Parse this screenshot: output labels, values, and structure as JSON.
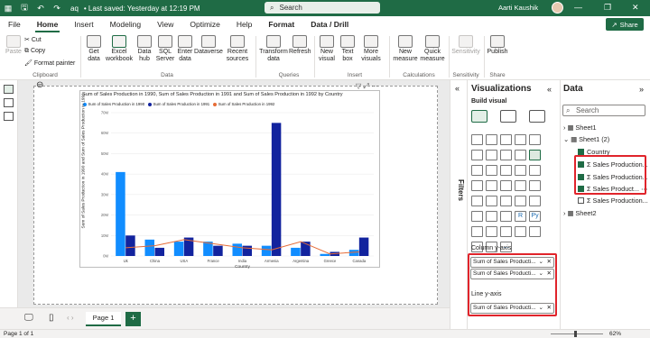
{
  "titlebar": {
    "filename": "aq",
    "saved": "• Last saved: Yesterday at 12:19 PM",
    "search_placeholder": "Search",
    "user": "Aarti Kaushik"
  },
  "menu": [
    "File",
    "Home",
    "Insert",
    "Modeling",
    "View",
    "Optimize",
    "Help",
    "Format",
    "Data / Drill"
  ],
  "share_label": "Share",
  "ribbon": {
    "paste": "Paste",
    "cut": "Cut",
    "copy": "Copy",
    "format_painter": "Format painter",
    "get_data": "Get data",
    "excel_workbook": "Excel workbook",
    "data_hub": "Data hub",
    "sql_server": "SQL Server",
    "enter_data": "Enter data",
    "dataverse": "Dataverse",
    "recent_sources": "Recent sources",
    "transform_data": "Transform data",
    "refresh": "Refresh",
    "new_visual": "New visual",
    "text_box": "Text box",
    "more_visuals": "More visuals",
    "new_measure": "New measure",
    "quick_measure": "Quick measure",
    "sensitivity": "Sensitivity",
    "publish": "Publish",
    "groups": {
      "clipboard": "Clipboard",
      "data": "Data",
      "queries": "Queries",
      "insert": "Insert",
      "calculations": "Calculations",
      "sensitivity": "Sensitivity",
      "share": "Share"
    }
  },
  "chart_data": {
    "type": "bar",
    "title": "Sum of Sales Production in 1990, Sum of Sales Production in 1991 and Sum of Sales Production in 1992 by Country",
    "xlabel": "Country",
    "ylabel": "Sum of Sales Production in 1990 and Sum of Sales Production in 1991",
    "ylim": [
      0,
      70
    ],
    "yticks": [
      "0M",
      "10M",
      "20M",
      "30M",
      "40M",
      "50M",
      "60M",
      "70M"
    ],
    "categories": [
      "Uk",
      "China",
      "USA",
      "France",
      "India",
      "Armenia",
      "Argentina",
      "Greece",
      "Canada"
    ],
    "series": [
      {
        "name": "Sum of Sales Production in 1990",
        "color": "#118dff",
        "values": [
          41,
          8,
          7,
          7,
          6,
          5,
          4,
          1,
          3
        ]
      },
      {
        "name": "Sum of Sales Production in 1991",
        "color": "#12239e",
        "values": [
          10,
          4,
          9,
          5,
          5,
          65,
          7,
          2,
          9
        ]
      },
      {
        "name": "Sum of Sales Production in 1992",
        "color": "#e66c37",
        "type": "line",
        "values": [
          4,
          5,
          8,
          6,
          4,
          3,
          7,
          1,
          2
        ]
      }
    ]
  },
  "filters_label": "Filters",
  "visualizations": {
    "title": "Visualizations",
    "build_visual": "Build visual",
    "column_yaxis": "Column y-axis",
    "line_yaxis": "Line y-axis",
    "column_fields": [
      "Sum of Sales Producti...",
      "Sum of Sales Producti..."
    ],
    "line_fields": [
      "Sum of Sales Producti..."
    ]
  },
  "data_pane": {
    "title": "Data",
    "search_placeholder": "Search",
    "sheet1": "Sheet1",
    "sheet1_2": "Sheet1 (2)",
    "country": "Country",
    "fields": [
      "Sales Production...",
      "Sales Production...",
      "Sales Product...",
      "Sales Production..."
    ],
    "sheet2": "Sheet2"
  },
  "page_tab": "Page 1",
  "status": {
    "page": "Page 1 of 1",
    "zoom": "62%"
  }
}
